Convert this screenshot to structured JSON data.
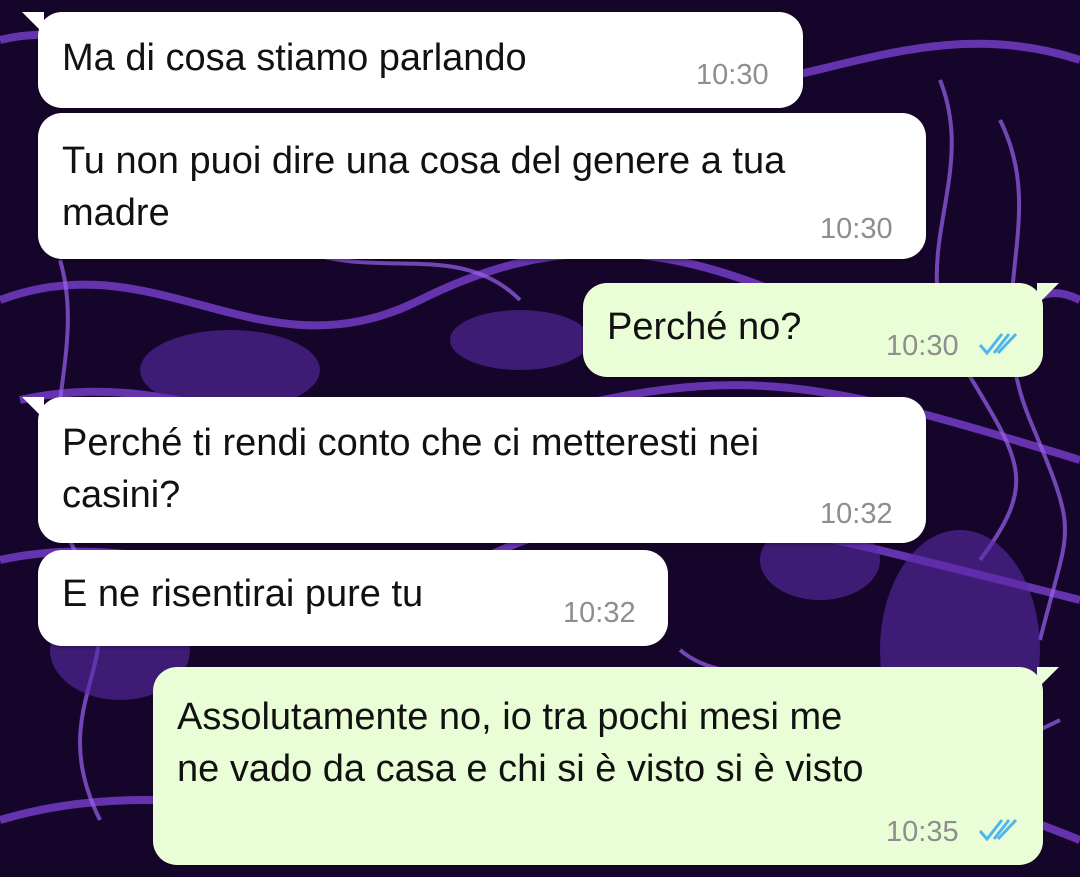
{
  "messages": [
    {
      "direction": "incoming",
      "text": "Ma di cosa stiamo parlando",
      "time": "10:30"
    },
    {
      "direction": "incoming",
      "text": "Tu non puoi dire una cosa del genere a tua\nmadre",
      "time": "10:30"
    },
    {
      "direction": "outgoing",
      "text": "Perché no?",
      "time": "10:30",
      "status_icon": "double-check-icon"
    },
    {
      "direction": "incoming",
      "text": "Perché ti rendi conto che ci metteresti nei\ncasini?",
      "time": "10:32"
    },
    {
      "direction": "incoming",
      "text": "E ne risentirai pure tu",
      "time": "10:32"
    },
    {
      "direction": "outgoing",
      "text": "Assolutamente no, io tra pochi mesi me\nne vado da casa e chi si è visto si è visto",
      "time": "10:35",
      "status_icon": "double-check-icon"
    }
  ],
  "colors": {
    "incoming_bubble": "#ffffff",
    "outgoing_bubble": "#e9fdd6",
    "read_ticks": "#4fb6ec",
    "wallpaper_purple": "#7a3fd0"
  }
}
